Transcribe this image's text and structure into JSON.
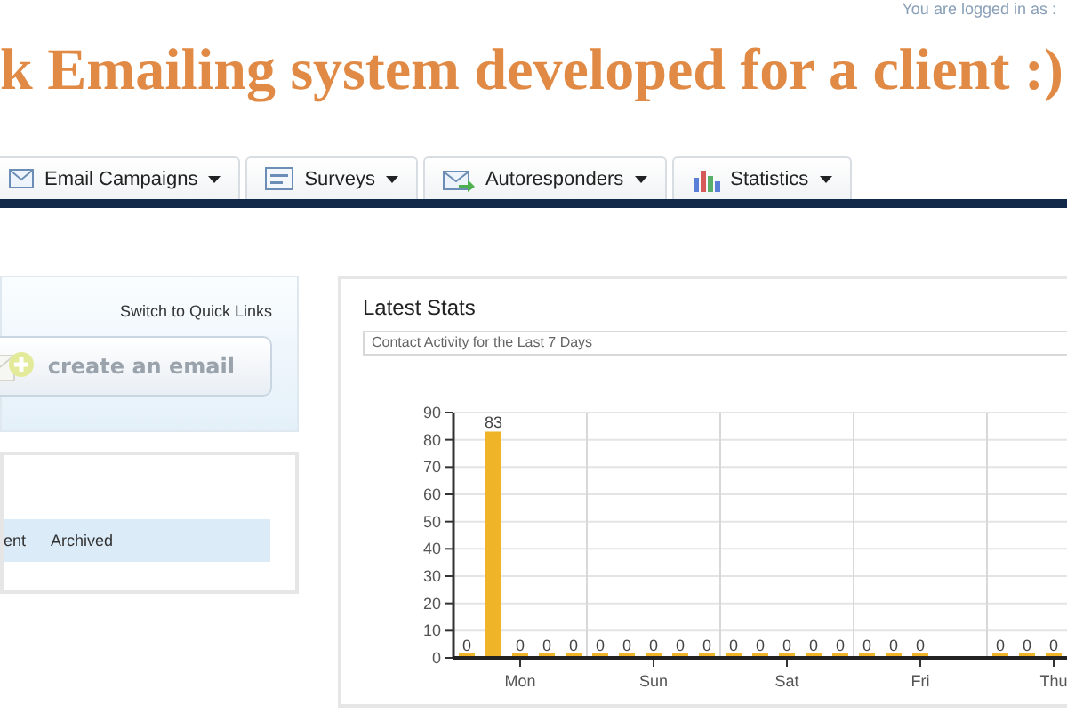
{
  "header": {
    "login_text": "You are logged in as :",
    "title": "k Emailing system developed for a client :)"
  },
  "nav_tabs": [
    {
      "label": "Email Campaigns"
    },
    {
      "label": "Surveys"
    },
    {
      "label": "Autoresponders"
    },
    {
      "label": "Statistics"
    }
  ],
  "quick_panel": {
    "link": "Switch to Quick Links",
    "button": "create an email"
  },
  "email_panel": {
    "tabs": [
      "ent",
      "Archived"
    ]
  },
  "stats_panel": {
    "title": "Latest Stats",
    "select": "Contact Activity for the Last 7 Days",
    "chart_data": {
      "type": "bar",
      "categories": [
        "Mon",
        "Sun",
        "Sat",
        "Fri",
        "Thu"
      ],
      "ylim": [
        0,
        90
      ],
      "yticks": [
        0,
        10,
        20,
        30,
        40,
        50,
        60,
        70,
        80,
        90
      ],
      "data_labels": true,
      "grid": true,
      "series": [
        {
          "color": "#f0b429",
          "values": [
            0,
            0,
            0,
            0,
            0
          ]
        },
        {
          "color": "#f0b429",
          "values": [
            83,
            0,
            0,
            0,
            0
          ]
        },
        {
          "color": "#f0b429",
          "values": [
            0,
            0,
            0,
            0,
            0
          ]
        },
        {
          "color": "#f0b429",
          "values": [
            0,
            0,
            0,
            null,
            null
          ]
        },
        {
          "color": "#f0b429",
          "values": [
            0,
            0,
            0,
            null,
            null
          ]
        }
      ]
    }
  }
}
